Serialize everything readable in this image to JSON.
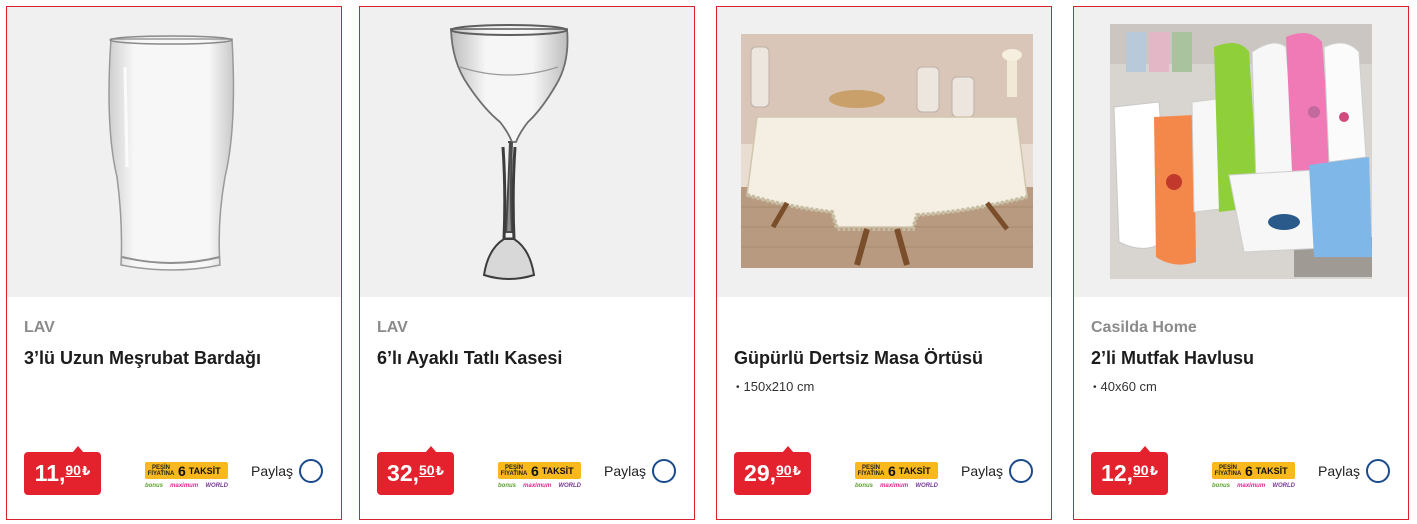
{
  "products": [
    {
      "brand": "LAV",
      "title": "3’lü Uzun Meşrubat Bardağı",
      "spec": "",
      "price_int": "11",
      "price_dec": "90",
      "currency": "₺",
      "image": "tall-glass-image"
    },
    {
      "brand": "LAV",
      "title": "6’lı Ayaklı Tatlı Kasesi",
      "spec": "",
      "price_int": "32",
      "price_dec": "50",
      "currency": "₺",
      "image": "stemmed-dessert-bowl-image"
    },
    {
      "brand": "",
      "title": "Güpürlü Dertsiz Masa Örtüsü",
      "spec": "150x210 cm",
      "price_int": "29",
      "price_dec": "90",
      "currency": "₺",
      "image": "tablecloth-image"
    },
    {
      "brand": "Casilda Home",
      "title": "2’li Mutfak Havlusu",
      "spec": "40x60 cm",
      "price_int": "12",
      "price_dec": "90",
      "currency": "₺",
      "image": "kitchen-towels-image"
    }
  ],
  "installment": {
    "pesin_line1": "PEŞİN",
    "pesin_line2": "FİYATINA",
    "count": "6",
    "word": "TAKSİT",
    "logo_bonus": "bonus",
    "logo_maximum": "maximum",
    "logo_world": "WORLD"
  },
  "share_label": "Paylaş",
  "colors": {
    "accent_red": "#e3222d",
    "card_border": "#d6232e",
    "installment_yellow": "#f9b81b",
    "share_circle": "#1a4a8c"
  }
}
